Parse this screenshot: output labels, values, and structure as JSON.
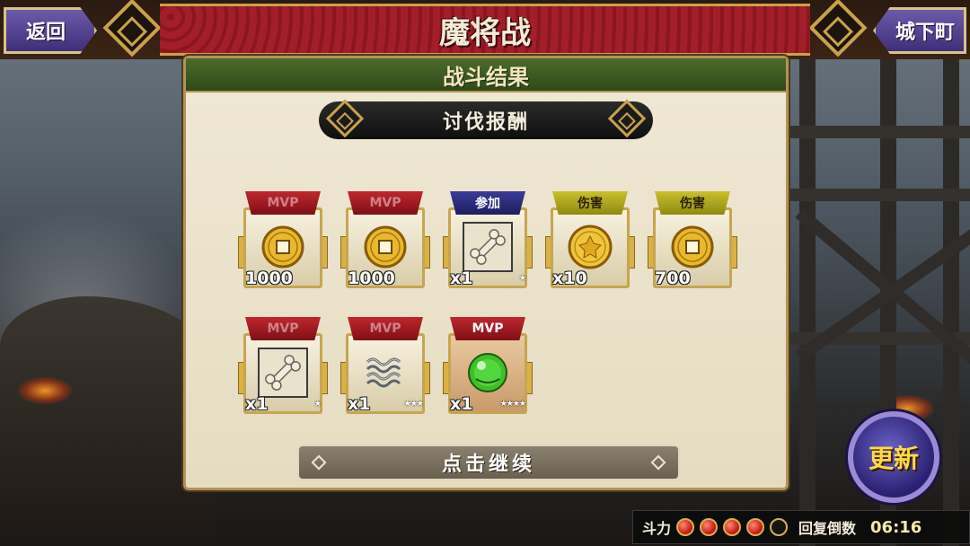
{
  "header": {
    "title": "魔将战",
    "back_label": "返回",
    "town_label": "城下町"
  },
  "panel": {
    "title": "战斗结果",
    "reward_header": "讨伐报酬",
    "continue_label": "点击继续"
  },
  "rewards": [
    {
      "tab": "MVP",
      "tab_color": "red",
      "icon": "gold-coin-icon",
      "quantity": "1000",
      "stars": ""
    },
    {
      "tab": "MVP",
      "tab_color": "red",
      "icon": "gold-coin-icon",
      "quantity": "1000",
      "stars": ""
    },
    {
      "tab": "参加",
      "tab_color": "blue",
      "icon": "bone-icon",
      "quantity": "x1",
      "stars": "★"
    },
    {
      "tab": "伤害",
      "tab_color": "yellow",
      "icon": "gold-medallion-icon",
      "quantity": "x10",
      "stars": ""
    },
    {
      "tab": "伤害",
      "tab_color": "yellow",
      "icon": "gold-coin-icon",
      "quantity": "700",
      "stars": ""
    },
    {
      "tab": "MVP",
      "tab_color": "red",
      "icon": "bone-icon",
      "quantity": "x1",
      "stars": "★"
    },
    {
      "tab": "MVP",
      "tab_color": "red",
      "icon": "iron-spring-icon",
      "quantity": "x1",
      "stars": "★★★"
    },
    {
      "tab": "MVP",
      "tab_color": "red",
      "icon": "green-orb-icon",
      "quantity": "x1",
      "stars": "★★★★"
    }
  ],
  "refresh_label": "更新",
  "status": {
    "stamina_label": "斗力",
    "stamina_filled": 4,
    "stamina_total": 5,
    "recover_label": "回复倒数",
    "timer": "06:16"
  },
  "colors": {
    "title_red": "#a21f2a",
    "panel_green": "#3a5a20",
    "button_purple": "#4a3a8a",
    "gold": "#c9a24a"
  }
}
